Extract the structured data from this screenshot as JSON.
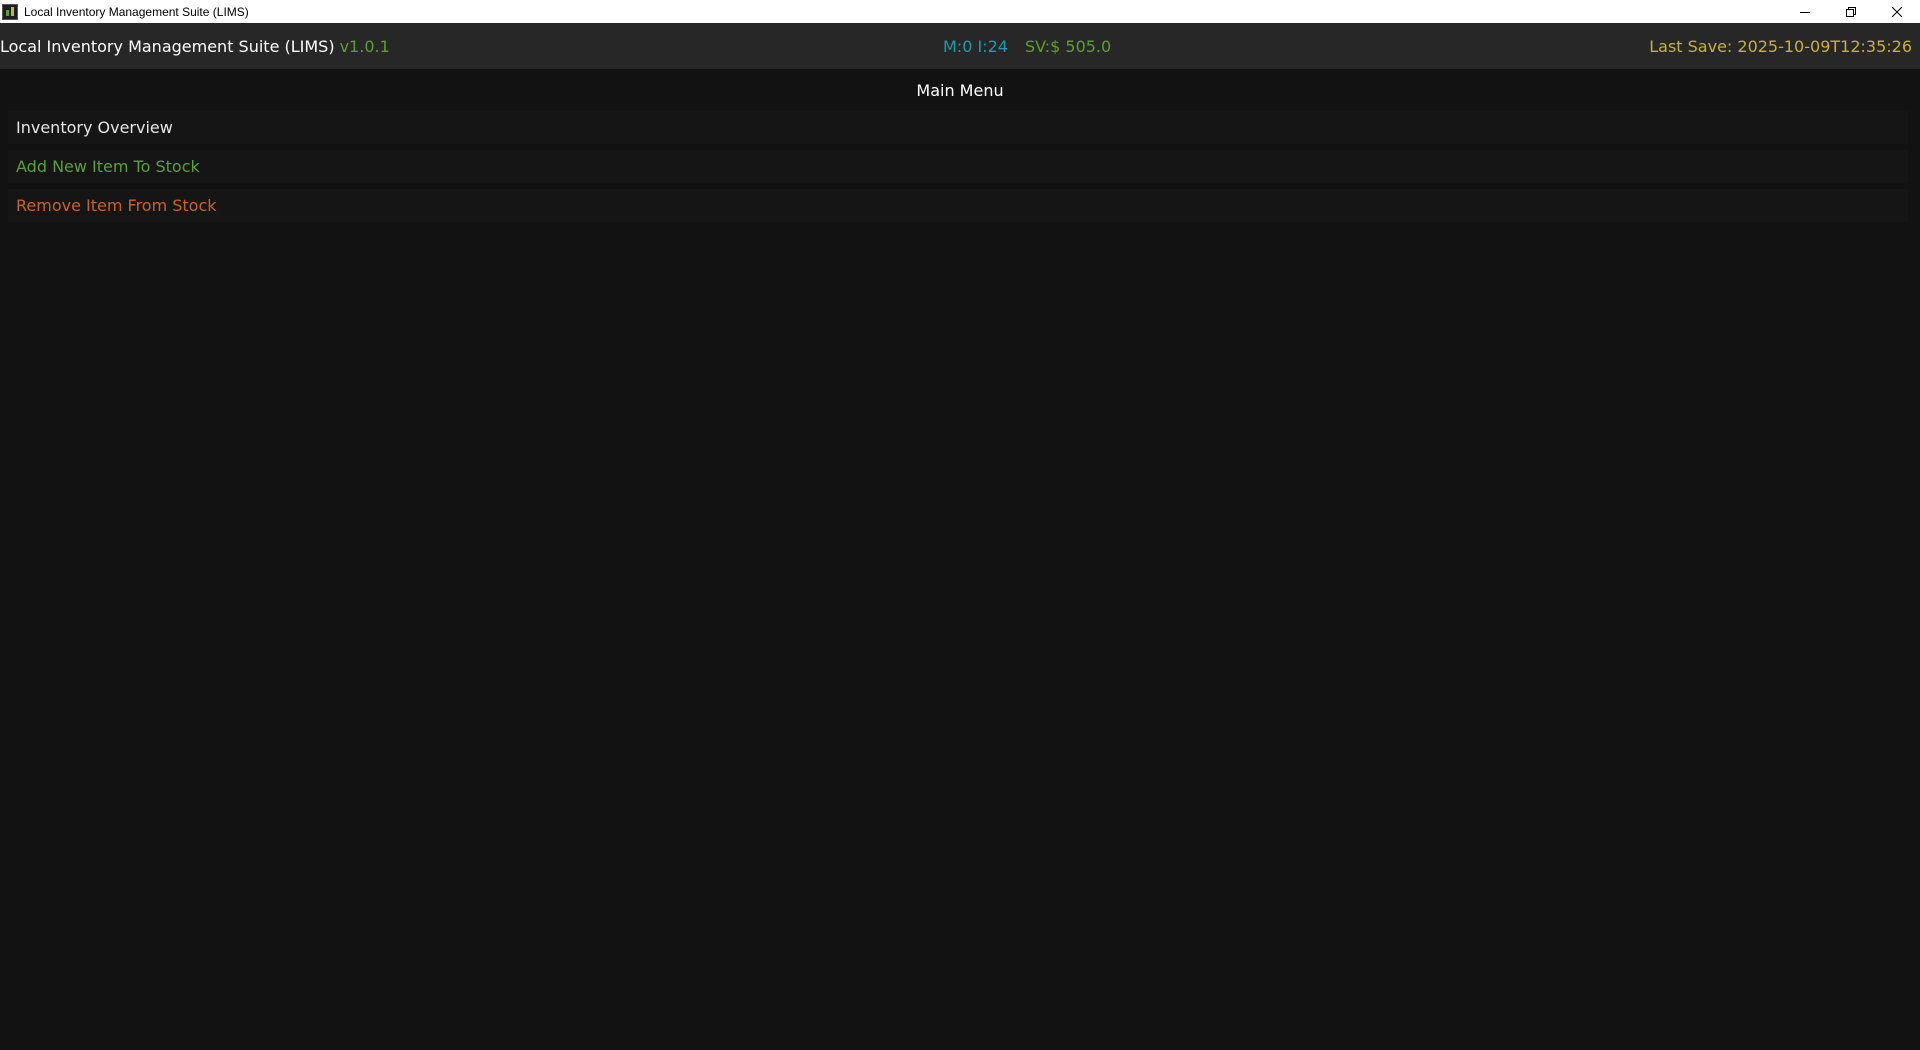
{
  "window": {
    "title": "Local Inventory Management Suite (LIMS)",
    "controls": {
      "minimize_icon": "minimize-icon",
      "restore_icon": "restore-icon",
      "close_icon": "close-icon"
    }
  },
  "header": {
    "app_name": "Local Inventory Management Suite (LIMS)",
    "version": "v1.0.1",
    "stats_mi": "M:0 I:24",
    "stats_sv": "SV:$ 505.0",
    "last_save": "Last Save: 2025-10-09T12:35:26"
  },
  "main": {
    "menu_title": "Main Menu",
    "items": [
      {
        "label": "Inventory Overview",
        "color": "#e6e6e6"
      },
      {
        "label": "Add New Item To Stock",
        "color": "#5aa02c"
      },
      {
        "label": "Remove Item From Stock",
        "color": "#c8641e"
      }
    ]
  },
  "colors": {
    "background": "#121212",
    "header_bg": "#272727",
    "accent_green": "#5aa02c",
    "accent_cyan": "#1e9bab",
    "accent_yellow": "#c9b22f",
    "accent_orange": "#c8641e"
  }
}
